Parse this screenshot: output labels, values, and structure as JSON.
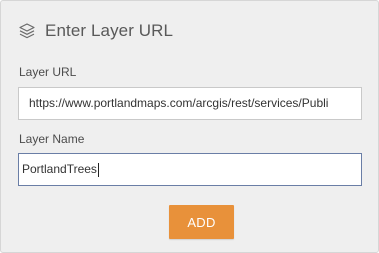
{
  "panel": {
    "title": "Enter Layer URL",
    "icon": "layers-icon"
  },
  "layer_url": {
    "label": "Layer URL",
    "value": "https://www.portlandmaps.com/arcgis/rest/services/Publi"
  },
  "layer_name": {
    "label": "Layer Name",
    "value": "PortlandTrees"
  },
  "actions": {
    "add_label": "ADD"
  },
  "colors": {
    "accent": "#e8913a",
    "panel_bg": "#efefef",
    "focus_border": "#6a7ea6"
  }
}
